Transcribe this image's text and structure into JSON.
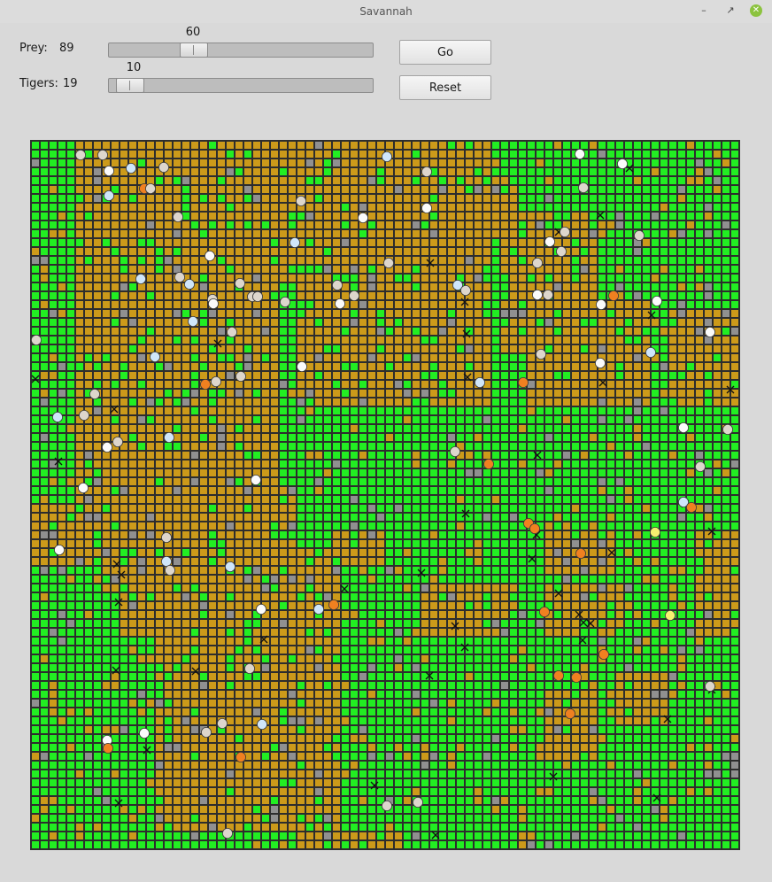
{
  "window": {
    "title": "Savannah"
  },
  "controls": {
    "prey_label": "Prey:",
    "prey_count": "89",
    "prey_slider_value": "60",
    "prey_slider_fraction": 0.3,
    "tigers_label": "Tigers:",
    "tigers_count": "19",
    "tigers_slider_value": "10",
    "tigers_slider_fraction": 0.03,
    "go_label": "Go",
    "reset_label": "Reset"
  },
  "board": {
    "cols": 80,
    "rows": 80,
    "colors": {
      "grass": "#22ee22",
      "dirt": "#cc9a1a",
      "rock": "#909090",
      "cell_border": "#2d2d2d",
      "prey_beige": "#ddd6cc",
      "prey_white": "#fbfbfb",
      "prey_blue": "#cfe6fa",
      "prey_orange": "#f08020",
      "prey_yellow": "#f6f070",
      "tiger_mark": "#111111"
    },
    "dirt_regions": [
      [
        5,
        0,
        50,
        14
      ],
      [
        5,
        2,
        28,
        44
      ],
      [
        8,
        30,
        20,
        51
      ],
      [
        0,
        41,
        13,
        48
      ],
      [
        10,
        46,
        35,
        56
      ],
      [
        14,
        52,
        35,
        78
      ],
      [
        28,
        0,
        46,
        16
      ],
      [
        30,
        14,
        52,
        30
      ],
      [
        42,
        0,
        52,
        20
      ],
      [
        44,
        4,
        55,
        12
      ],
      [
        53,
        8,
        64,
        24
      ],
      [
        56,
        18,
        70,
        30
      ],
      [
        72,
        19,
        80,
        30
      ],
      [
        75,
        44,
        80,
        56
      ],
      [
        58,
        50,
        67,
        56
      ],
      [
        58,
        44,
        66,
        49
      ],
      [
        30,
        78,
        42,
        80
      ],
      [
        44,
        50,
        54,
        56
      ],
      [
        66,
        60,
        72,
        66
      ],
      [
        58,
        62,
        64,
        70
      ],
      [
        22,
        38,
        30,
        46
      ],
      [
        20,
        56,
        26,
        62
      ],
      [
        34,
        44,
        40,
        48
      ]
    ],
    "prey": [
      [
        5.6,
        1.6,
        "b"
      ],
      [
        8.1,
        1.6,
        "b"
      ],
      [
        8.8,
        3.4,
        "w"
      ],
      [
        11.3,
        3.1,
        "c"
      ],
      [
        15.0,
        3.0,
        "b"
      ],
      [
        12.8,
        5.4,
        "o"
      ],
      [
        13.5,
        5.4,
        "b"
      ],
      [
        8.8,
        6.2,
        "c"
      ],
      [
        16.6,
        8.6,
        "b"
      ],
      [
        20.2,
        13.0,
        "w"
      ],
      [
        12.4,
        15.6,
        "c"
      ],
      [
        16.8,
        15.4,
        "b"
      ],
      [
        17.9,
        16.2,
        "c"
      ],
      [
        20.5,
        17.9,
        "b"
      ],
      [
        20.6,
        18.4,
        "w"
      ],
      [
        23.6,
        16.1,
        "b"
      ],
      [
        25.0,
        17.6,
        "b"
      ],
      [
        25.6,
        17.6,
        "b"
      ],
      [
        28.7,
        18.2,
        "b"
      ],
      [
        18.3,
        20.4,
        "c"
      ],
      [
        22.7,
        21.6,
        "b"
      ],
      [
        14.0,
        24.4,
        "c"
      ],
      [
        20.9,
        27.2,
        "b"
      ],
      [
        23.7,
        26.6,
        "b"
      ],
      [
        19.7,
        27.5,
        "o"
      ],
      [
        7.2,
        28.6,
        "b"
      ],
      [
        6.0,
        31.0,
        "b"
      ],
      [
        3.0,
        31.2,
        "c"
      ],
      [
        0.6,
        22.5,
        "b"
      ],
      [
        15.6,
        33.5,
        "c"
      ],
      [
        9.8,
        34.0,
        "b"
      ],
      [
        8.6,
        34.6,
        "w"
      ],
      [
        25.4,
        38.3,
        "w"
      ],
      [
        5.9,
        39.2,
        "w"
      ],
      [
        15.3,
        44.8,
        "b"
      ],
      [
        3.2,
        46.2,
        "w"
      ],
      [
        15.3,
        47.5,
        "c"
      ],
      [
        15.7,
        48.5,
        "b"
      ],
      [
        22.5,
        48.1,
        "c"
      ],
      [
        26.0,
        52.9,
        "w"
      ],
      [
        32.5,
        52.9,
        "c"
      ],
      [
        34.2,
        52.4,
        "o"
      ],
      [
        24.7,
        59.6,
        "b"
      ],
      [
        21.6,
        65.8,
        "b"
      ],
      [
        26.1,
        65.9,
        "c"
      ],
      [
        19.8,
        66.8,
        "b"
      ],
      [
        12.8,
        66.9,
        "w"
      ],
      [
        8.6,
        67.7,
        "w"
      ],
      [
        8.7,
        68.6,
        "o"
      ],
      [
        23.7,
        69.6,
        "o"
      ],
      [
        40.2,
        75.1,
        "b"
      ],
      [
        43.7,
        74.7,
        "b"
      ],
      [
        22.2,
        78.2,
        "b"
      ],
      [
        30.5,
        6.8,
        "b"
      ],
      [
        29.8,
        11.5,
        "c"
      ],
      [
        37.5,
        8.7,
        "w"
      ],
      [
        40.2,
        1.8,
        "c"
      ],
      [
        44.7,
        3.5,
        "b"
      ],
      [
        44.7,
        7.6,
        "w"
      ],
      [
        40.4,
        13.8,
        "b"
      ],
      [
        34.6,
        16.3,
        "b"
      ],
      [
        36.5,
        17.5,
        "b"
      ],
      [
        34.9,
        18.4,
        "w"
      ],
      [
        30.6,
        25.5,
        "w"
      ],
      [
        48.2,
        16.3,
        "c"
      ],
      [
        49.1,
        16.9,
        "b"
      ],
      [
        50.7,
        27.3,
        "c"
      ],
      [
        55.6,
        27.3,
        "o"
      ],
      [
        47.9,
        35.1,
        "b"
      ],
      [
        51.7,
        36.5,
        "o"
      ],
      [
        56.2,
        43.2,
        "o"
      ],
      [
        56.9,
        43.8,
        "o"
      ],
      [
        60.3,
        10.3,
        "b"
      ],
      [
        58.6,
        11.4,
        "w"
      ],
      [
        59.9,
        12.5,
        "b"
      ],
      [
        57.2,
        13.8,
        "b"
      ],
      [
        62.0,
        1.5,
        "w"
      ],
      [
        62.4,
        5.3,
        "b"
      ],
      [
        66.8,
        2.6,
        "w"
      ],
      [
        68.7,
        10.7,
        "b"
      ],
      [
        57.2,
        17.4,
        "w"
      ],
      [
        58.4,
        17.4,
        "b"
      ],
      [
        65.8,
        17.5,
        "o"
      ],
      [
        64.4,
        18.5,
        "w"
      ],
      [
        70.7,
        18.1,
        "w"
      ],
      [
        57.6,
        24.1,
        "b"
      ],
      [
        64.3,
        25.1,
        "w"
      ],
      [
        70.0,
        23.9,
        "c"
      ],
      [
        76.7,
        21.6,
        "w"
      ],
      [
        73.7,
        32.4,
        "w"
      ],
      [
        78.7,
        32.6,
        "b"
      ],
      [
        75.6,
        36.8,
        "b"
      ],
      [
        73.7,
        40.8,
        "c"
      ],
      [
        74.6,
        41.4,
        "o"
      ],
      [
        70.5,
        44.2,
        "y"
      ],
      [
        62.1,
        46.6,
        "o"
      ],
      [
        58.0,
        53.2,
        "o"
      ],
      [
        64.7,
        58.0,
        "o"
      ],
      [
        59.6,
        60.4,
        "o"
      ],
      [
        61.6,
        60.6,
        "o"
      ],
      [
        72.2,
        53.6,
        "y"
      ],
      [
        60.9,
        64.7,
        "o"
      ],
      [
        76.7,
        61.6,
        "b"
      ]
    ],
    "tigers": [
      [
        0.5,
        26.9
      ],
      [
        3.1,
        36.2
      ],
      [
        9.4,
        30.3
      ],
      [
        9.7,
        47.8
      ],
      [
        10.2,
        49.0
      ],
      [
        9.9,
        52.1
      ],
      [
        9.6,
        59.8
      ],
      [
        9.9,
        74.8
      ],
      [
        13.1,
        68.8
      ],
      [
        18.6,
        59.9
      ],
      [
        21.1,
        22.9
      ],
      [
        26.3,
        56.3
      ],
      [
        35.4,
        50.6
      ],
      [
        38.8,
        72.8
      ],
      [
        45.1,
        13.8
      ],
      [
        49.2,
        21.8
      ],
      [
        49.3,
        26.7
      ],
      [
        49.0,
        18.2
      ],
      [
        49.1,
        42.1
      ],
      [
        47.9,
        54.8
      ],
      [
        49.0,
        57.2
      ],
      [
        45.0,
        60.4
      ],
      [
        44.1,
        48.8
      ],
      [
        57.1,
        44.5
      ],
      [
        56.6,
        47.2
      ],
      [
        57.2,
        35.5
      ],
      [
        59.6,
        10.3
      ],
      [
        64.3,
        8.4
      ],
      [
        64.6,
        18.6
      ],
      [
        64.6,
        27.3
      ],
      [
        70.1,
        19.7
      ],
      [
        79.0,
        28.1
      ],
      [
        76.9,
        44.1
      ],
      [
        73.9,
        41.0
      ],
      [
        65.6,
        46.5
      ],
      [
        59.6,
        51.1
      ],
      [
        61.9,
        53.5
      ],
      [
        62.4,
        54.4
      ],
      [
        62.3,
        56.4
      ],
      [
        63.2,
        54.5
      ],
      [
        71.9,
        65.3
      ],
      [
        59.0,
        71.8
      ],
      [
        70.7,
        74.2
      ],
      [
        76.9,
        62.0
      ],
      [
        45.7,
        78.4
      ],
      [
        67.6,
        3.1
      ]
    ]
  }
}
